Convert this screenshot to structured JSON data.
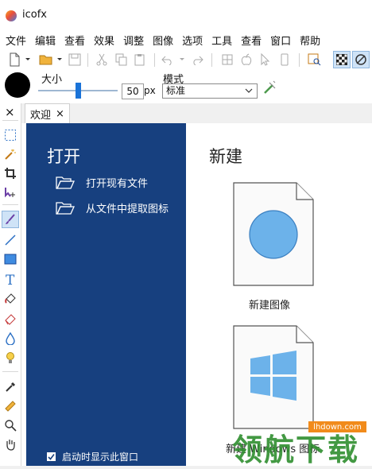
{
  "window": {
    "title": "icofx"
  },
  "menu": [
    "文件",
    "编辑",
    "查看",
    "效果",
    "调整",
    "图像",
    "选项",
    "工具",
    "查看",
    "窗口",
    "帮助"
  ],
  "options": {
    "size_label": "大小",
    "size_value": "50",
    "size_unit": "px",
    "size_level_fraction": 0.5,
    "mode_label": "模式",
    "mode_value": "标准"
  },
  "tabs": {
    "welcome_label": "欢迎",
    "close_glyph": "×"
  },
  "panel": {
    "close_glyph": "×"
  },
  "welcome": {
    "open_title": "打开",
    "open_existing": "打开现有文件",
    "extract_icon": "从文件中提取图标",
    "startup_checkbox": "启动时显示此窗口",
    "startup_checked": true,
    "new_title": "新建",
    "new_image": "新建图像",
    "new_windows_icon": "新建 Windows 图标"
  },
  "watermark": {
    "text": "领航下载",
    "url": "lhdown.com"
  },
  "colors": {
    "accent": "#17407f",
    "primary_color": "#000000",
    "tile_blue": "#6cb2ea",
    "watermark_green": "#2f8f2f",
    "watermark_orange": "#f18b1b"
  }
}
